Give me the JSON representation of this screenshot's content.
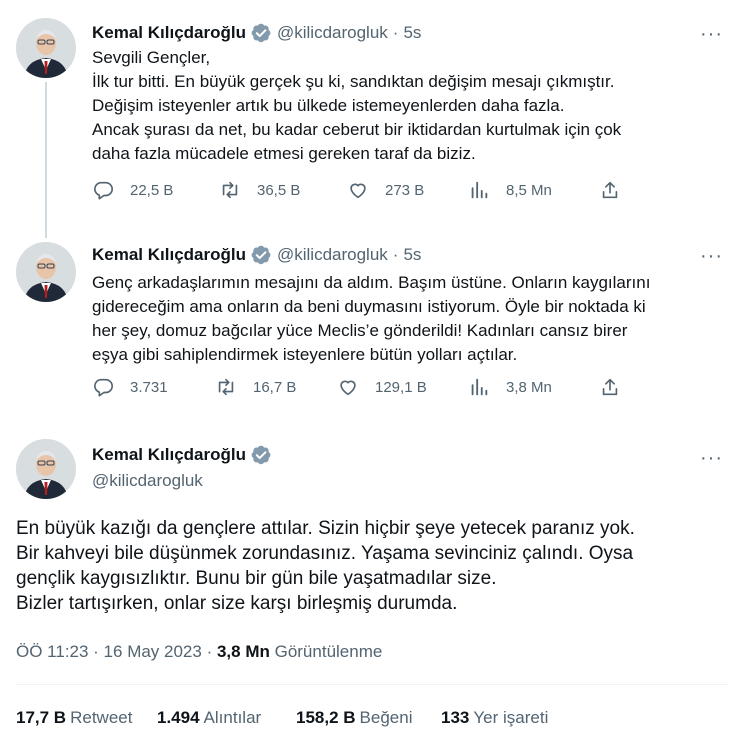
{
  "author": {
    "name": "Kemal Kılıçdaroğlu",
    "handle": "@kilicdarogluk"
  },
  "thread": [
    {
      "time": "5s",
      "dot": "·",
      "more": "···",
      "lines": [
        "Sevgili Gençler,",
        "İlk tur bitti. En büyük gerçek şu ki, sandıktan değişim mesajı çıkmıştır.",
        "Değişim isteyenler artık bu ülkede istemeyenlerden daha fazla.",
        "Ancak şurası da net, bu kadar ceberut bir iktidardan kurtulmak için çok",
        "daha fazla mücadele etmesi gereken taraf da biziz."
      ],
      "replies": "22,5 B",
      "retweets": "36,5 B",
      "likes": "273 B",
      "views": "8,5 Mn"
    },
    {
      "time": "5s",
      "dot": "·",
      "more": "···",
      "lines": [
        "Genç arkadaşlarımın mesajını da aldım. Başım üstüne. Onların kaygılarını",
        "gidereceğim ama onların da beni duymasını istiyorum. Öyle bir noktada ki",
        "her şey, domuz bağcılar yüce Meclis’e gönderildi! Kadınları cansız birer",
        "eşya gibi sahiplendirmek isteyenlere bütün yolları açtılar."
      ],
      "replies": "3.731",
      "retweets": "16,7 B",
      "likes": "129,1 B",
      "views": "3,8 Mn"
    }
  ],
  "main": {
    "more": "···",
    "lines": [
      "En büyük kazığı da gençlere attılar. Sizin hiçbir şeye yetecek paranız yok.",
      "Bir kahveyi bile düşünmek zorundasınız. Yaşama sevinciniz çalındı. Oysa",
      "gençlik kaygısızlıktır. Bunu bir gün bile yaşatmadılar size.",
      "Bizler tartışırken, onlar size karşı birleşmiş durumda."
    ],
    "timestamp": "ÖÖ 11:23 · 16 May 2023 · ",
    "views_count": "3,8 Mn",
    "views_label": " Görüntülenme",
    "stats": {
      "retweets_count": "17,7 B",
      "retweets_label": "Retweet",
      "quotes_count": "1.494",
      "quotes_label": "Alıntılar",
      "likes_count": "158,2 B",
      "likes_label": "Beğeni",
      "bookmarks_count": "133",
      "bookmarks_label": "Yer işareti"
    }
  },
  "colors": {
    "text": "#0f1419",
    "secondary": "#536471",
    "verified_badge": "#829aab",
    "thread_line": "#cfd9de",
    "divider": "#eff3f4"
  },
  "icons": [
    "avatar-portrait",
    "verified-badge-icon",
    "reply-icon",
    "retweet-icon",
    "like-icon",
    "views-icon",
    "share-icon",
    "more-icon"
  ]
}
